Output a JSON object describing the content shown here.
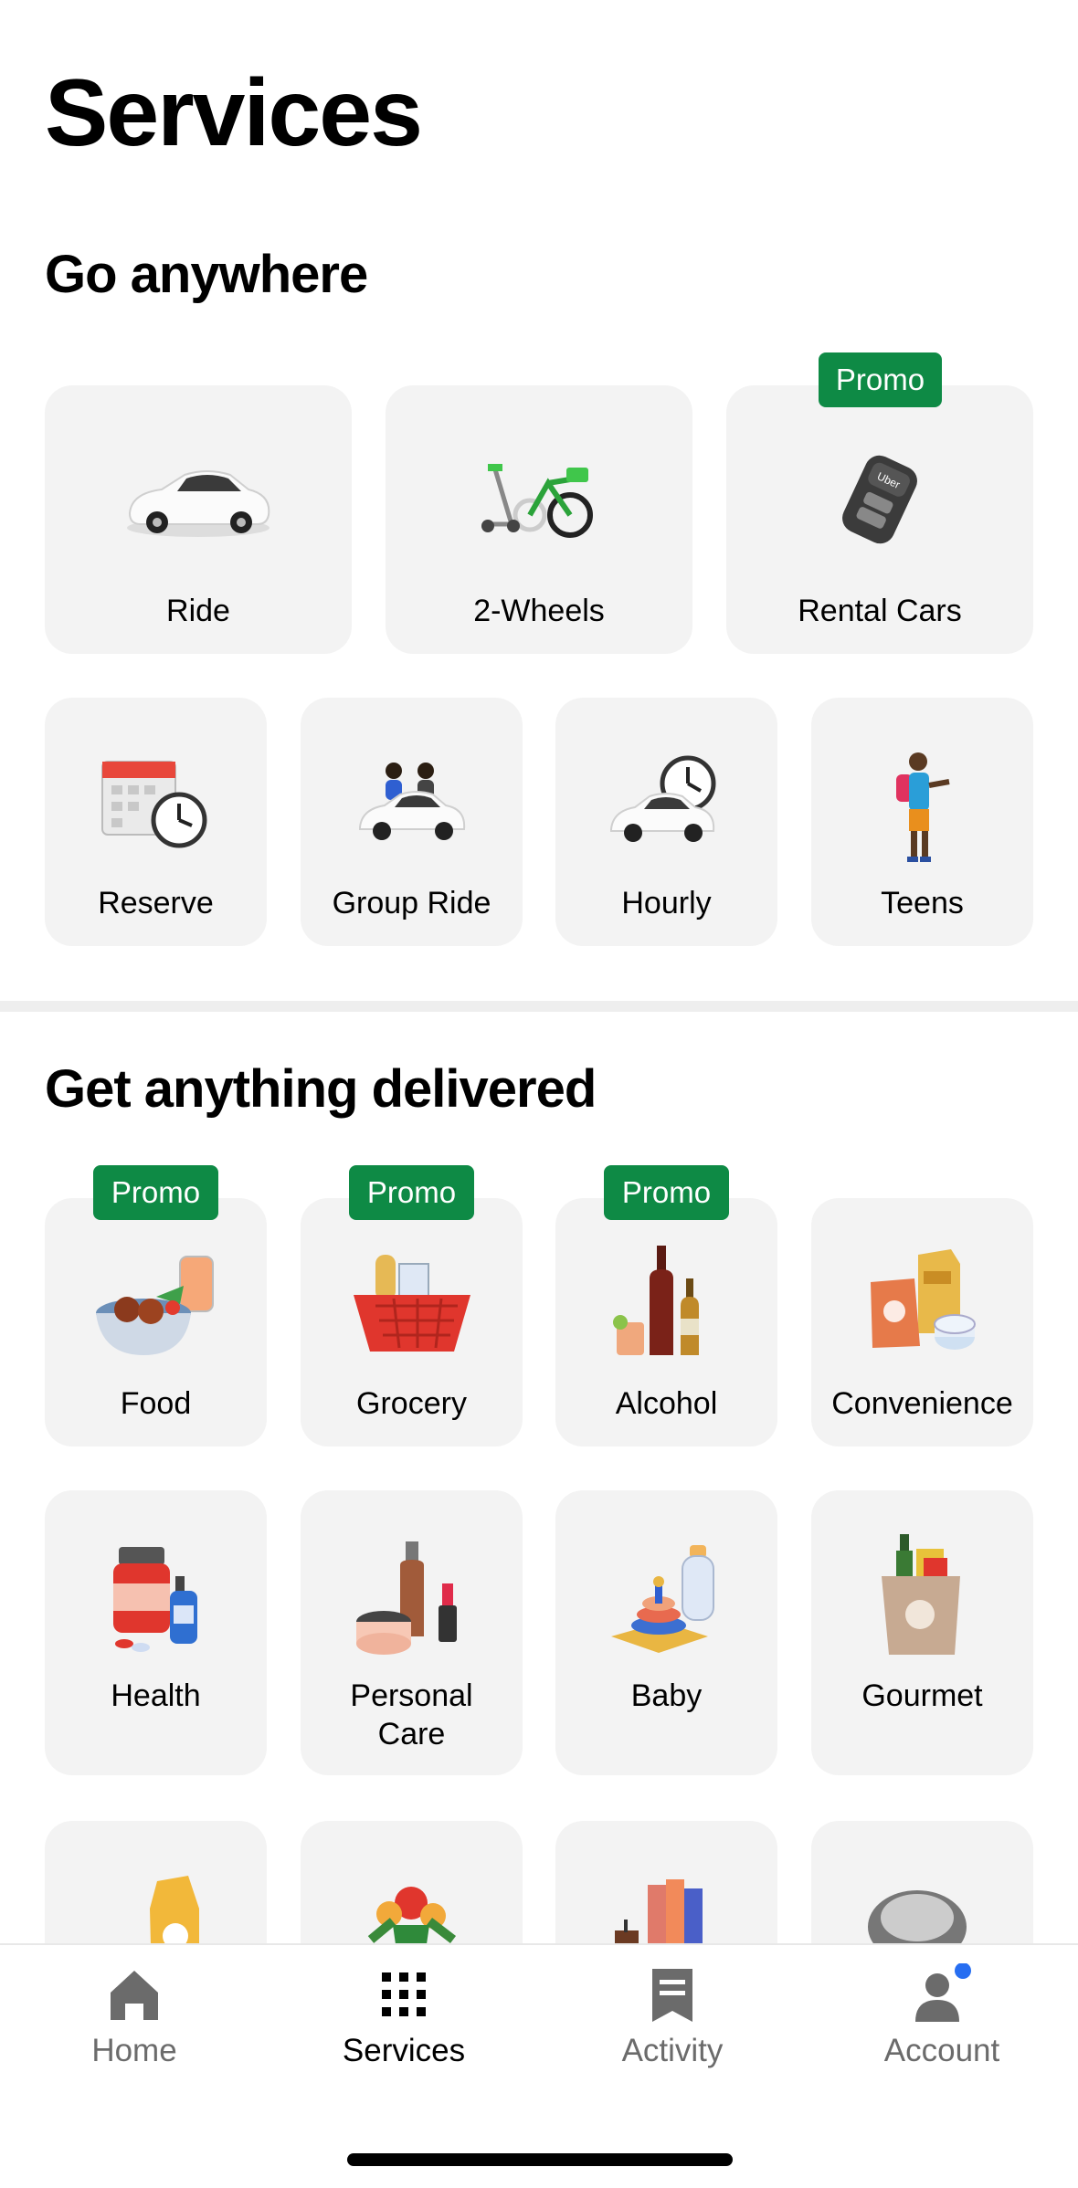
{
  "header": {
    "title": "Services"
  },
  "sections": {
    "go_anywhere": {
      "title": "Go anywhere",
      "items": [
        {
          "label": "Ride",
          "icon": "car-icon",
          "promo": ""
        },
        {
          "label": "2-Wheels",
          "icon": "bike-scooter-icon",
          "promo": ""
        },
        {
          "label": "Rental Cars",
          "icon": "car-key-icon",
          "promo": "Promo"
        },
        {
          "label": "Reserve",
          "icon": "calendar-clock-icon",
          "promo": ""
        },
        {
          "label": "Group Ride",
          "icon": "group-car-icon",
          "promo": ""
        },
        {
          "label": "Hourly",
          "icon": "car-clock-icon",
          "promo": ""
        },
        {
          "label": "Teens",
          "icon": "teen-icon",
          "promo": ""
        }
      ]
    },
    "delivered": {
      "title": "Get anything delivered",
      "items": [
        {
          "label": "Food",
          "icon": "food-bowl-icon",
          "promo": "Promo"
        },
        {
          "label": "Grocery",
          "icon": "grocery-basket-icon",
          "promo": "Promo"
        },
        {
          "label": "Alcohol",
          "icon": "bottles-icon",
          "promo": "Promo"
        },
        {
          "label": "Convenience",
          "icon": "convenience-bags-icon",
          "promo": ""
        },
        {
          "label": "Health",
          "icon": "medicine-icon",
          "promo": ""
        },
        {
          "label": "Personal Care",
          "label_line1": "Personal",
          "label_line2": "Care",
          "icon": "cosmetics-icon",
          "promo": ""
        },
        {
          "label": "Baby",
          "icon": "baby-toys-icon",
          "promo": ""
        },
        {
          "label": "Gourmet",
          "icon": "gourmet-bag-icon",
          "promo": ""
        },
        {
          "label": "",
          "icon": "pet-food-icon",
          "promo": ""
        },
        {
          "label": "",
          "icon": "flowers-icon",
          "promo": ""
        },
        {
          "label": "",
          "icon": "books-candle-icon",
          "promo": ""
        },
        {
          "label": "",
          "icon": "computer-mouse-icon",
          "promo": ""
        }
      ]
    }
  },
  "tabbar": {
    "tabs": [
      {
        "label": "Home",
        "icon": "home-icon",
        "active": false
      },
      {
        "label": "Services",
        "icon": "grid-icon",
        "active": true
      },
      {
        "label": "Activity",
        "icon": "receipt-icon",
        "active": false
      },
      {
        "label": "Account",
        "icon": "person-icon",
        "active": false,
        "badge": true
      }
    ]
  },
  "colors": {
    "promo": "#0e8a45",
    "tile": "#f3f3f3",
    "badge": "#276ef1"
  }
}
